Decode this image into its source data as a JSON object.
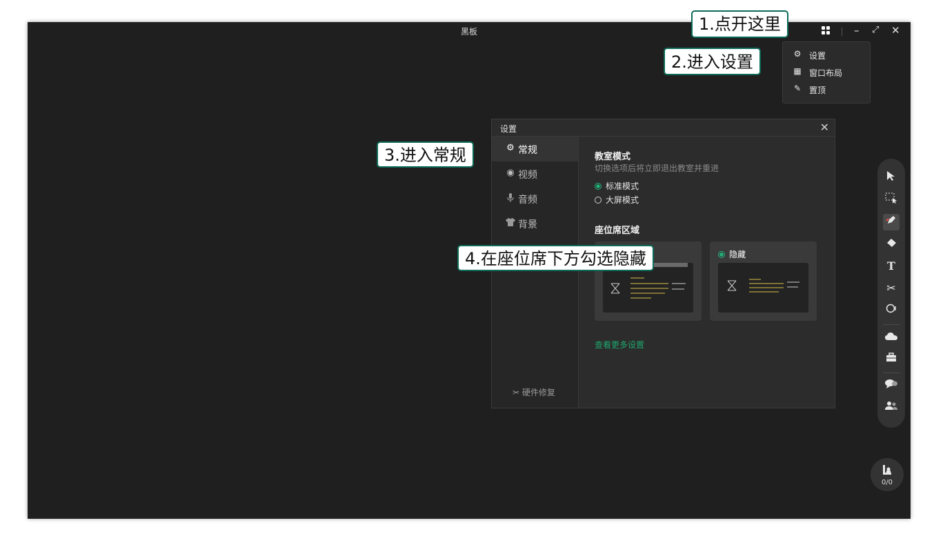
{
  "window": {
    "title": "黑板",
    "controls": {
      "minimize": "–",
      "maximize": "⤢",
      "close": "✕"
    }
  },
  "popup_menu": {
    "items": [
      {
        "label": "设置",
        "icon": "gear-icon"
      },
      {
        "label": "窗口布局",
        "icon": "layout-icon"
      },
      {
        "label": "置顶",
        "icon": "pin-icon"
      }
    ]
  },
  "dialog": {
    "title": "设置",
    "close": "✕",
    "sidebar": [
      {
        "label": "常规",
        "icon": "gear-icon",
        "active": true
      },
      {
        "label": "视频",
        "icon": "camera-icon",
        "active": false
      },
      {
        "label": "音频",
        "icon": "microphone-icon",
        "active": false
      },
      {
        "label": "背景",
        "icon": "shirt-icon",
        "active": false
      }
    ],
    "footer": "硬件修复",
    "classroom": {
      "title": "教室模式",
      "subtitle": "切换选项后将立即退出教室并重进",
      "options": [
        {
          "label": "标准模式",
          "selected": true
        },
        {
          "label": "大屏模式",
          "selected": false
        }
      ]
    },
    "seat_area": {
      "title": "座位席区域",
      "hide_option": {
        "label": "隐藏",
        "selected": true
      }
    },
    "more_link": "查看更多设置"
  },
  "seat_counter": "0/0",
  "callouts": {
    "step1": "1.点开这里",
    "step2": "2.进入设置",
    "step3": "3.进入常规",
    "step4": "4.在座位席下方勾选隐藏"
  },
  "colors": {
    "accent": "#22b37a",
    "callout_border": "#0b6b57",
    "app_bg": "#1f1f1f"
  }
}
